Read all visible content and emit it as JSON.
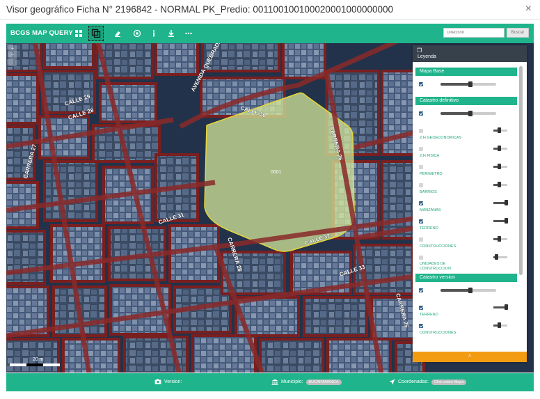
{
  "window": {
    "title": "Visor geográfico Ficha N° 2196842 - NORMAL PK_Predio: 001100100100020001000000000",
    "close_label": "×"
  },
  "toolbar": {
    "brand": "BCGS MAP QUERY",
    "tools": [
      {
        "name": "grid-view-icon"
      },
      {
        "name": "layers-icon"
      },
      {
        "name": "eraser-icon"
      },
      {
        "name": "target-icon"
      },
      {
        "name": "info-icon"
      },
      {
        "name": "download-icon"
      },
      {
        "name": "more-icon"
      }
    ],
    "search_placeholder": "Dirección",
    "search_button": "Buscar"
  },
  "map": {
    "streets": [
      {
        "label": "CALLE 30"
      },
      {
        "label": "CALLE 31"
      },
      {
        "label": "CALLE 32"
      },
      {
        "label": "CALLE 33"
      },
      {
        "label": "CALLE 29"
      },
      {
        "label": "CALLE 28"
      },
      {
        "label": "CARRERA 27"
      },
      {
        "label": "CARRERA 26"
      },
      {
        "label": "CARRERA 28"
      },
      {
        "label": "CARRERA 25"
      },
      {
        "label": "AVENIDA QUEBRADA SECA"
      }
    ],
    "parcel_label": "0001",
    "scale_label": "20 m"
  },
  "legend": {
    "title": "Leyenda",
    "groups": [
      {
        "name": "Mapa Base",
        "opacity": 0.55,
        "layers": []
      },
      {
        "name": "Catastro definitivo",
        "opacity": 0.55,
        "layers": [
          {
            "label": "Z.H GEOECONOMICAS",
            "checked": false,
            "opacity": 0.4
          },
          {
            "label": "Z.H FISICA",
            "checked": false,
            "opacity": 0.4
          },
          {
            "label": "PERIMETRO",
            "checked": false,
            "opacity": 0.4
          },
          {
            "label": "BARRIOS",
            "checked": false,
            "opacity": 0.4
          },
          {
            "label": "MANZANAS",
            "checked": true,
            "opacity": 0.9
          },
          {
            "label": "TERRENO",
            "checked": true,
            "opacity": 0.9
          },
          {
            "label": "CONSTRUCCIONES",
            "checked": false,
            "opacity": 0.4
          },
          {
            "label": "UNIDADES DE CONSTRUCCION",
            "checked": false,
            "opacity": 0.2
          }
        ]
      },
      {
        "name": "Catastro version",
        "opacity": 0.55,
        "layers": [
          {
            "label": "TERRENO",
            "checked": true,
            "opacity": 0.9
          },
          {
            "label": "CONSTRUCCIONES",
            "checked": true,
            "opacity": 0.4
          }
        ]
      }
    ],
    "footer_label": "^"
  },
  "footer": {
    "version_label": "Version:",
    "municipio_label": "Municipio:",
    "municipio_value": "BUCARAMANGA",
    "coordenadas_label": "Coordenadas:",
    "coordenadas_value": "Click sobre Mapa"
  },
  "colors": {
    "accent": "#1fb48b",
    "legend_header": "#37414c",
    "collapse_bar": "#f39c12",
    "parcel_fill": "#d4e79a",
    "street_outline": "#7a1f1f"
  }
}
